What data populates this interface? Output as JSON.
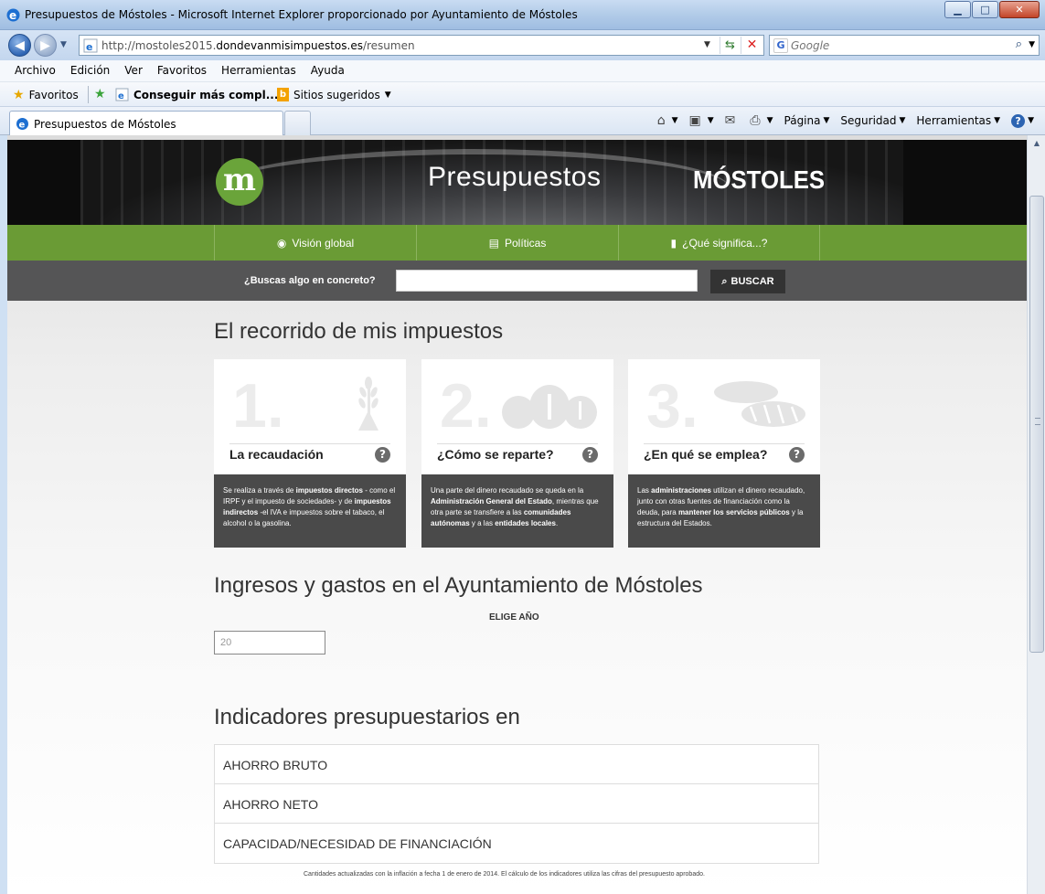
{
  "window": {
    "title": "Presupuestos de Móstoles - Microsoft Internet Explorer proporcionado por Ayuntamiento de Móstoles",
    "minimize": "▁",
    "maximize": "□",
    "close": "✕"
  },
  "address": {
    "url_prefix": "http://mostoles2015.",
    "url_domain": "dondevanmisimpuestos.es",
    "url_suffix": "/resumen",
    "search_placeholder": "Google"
  },
  "menu": [
    "Archivo",
    "Edición",
    "Ver",
    "Favoritos",
    "Herramientas",
    "Ayuda"
  ],
  "favorites": {
    "label": "Favoritos",
    "get_more": "Conseguir más compl...",
    "suggested": "Sitios sugeridos"
  },
  "tab": {
    "label": "Presupuestos de Móstoles"
  },
  "commands": {
    "page": "Página",
    "security": "Seguridad",
    "tools": "Herramientas"
  },
  "site": {
    "title": "Presupuestos",
    "city": "MÓSTOLES",
    "logo_letter": "m",
    "nav": [
      {
        "label": "Visión global",
        "icon": "◉"
      },
      {
        "label": "Políticas",
        "icon": "▤"
      },
      {
        "label": "¿Qué significa...?",
        "icon": "▮"
      }
    ],
    "search_label": "¿Buscas algo en concreto?",
    "search_button": "BUSCAR"
  },
  "main": {
    "heading1": "El recorrido de mis impuestos",
    "cards": [
      {
        "num": "1.",
        "title": "La recaudación"
      },
      {
        "num": "2.",
        "title": "¿Cómo se reparte?"
      },
      {
        "num": "3.",
        "title": "¿En qué se emplea?"
      }
    ],
    "heading2": "Ingresos y gastos en el Ayuntamiento de Móstoles",
    "elige": "ELIGE AÑO",
    "year_value": "20",
    "heading3": "Indicadores presupuestarios en",
    "indicators": [
      "AHORRO BRUTO",
      "AHORRO NETO",
      "CAPACIDAD/NECESIDAD DE FINANCIACIÓN"
    ],
    "footnote": "Cantidades actualizadas con la inflación a fecha 1 de enero de 2014. El cálculo de los indicadores utiliza las cifras del presupuesto aprobado."
  }
}
